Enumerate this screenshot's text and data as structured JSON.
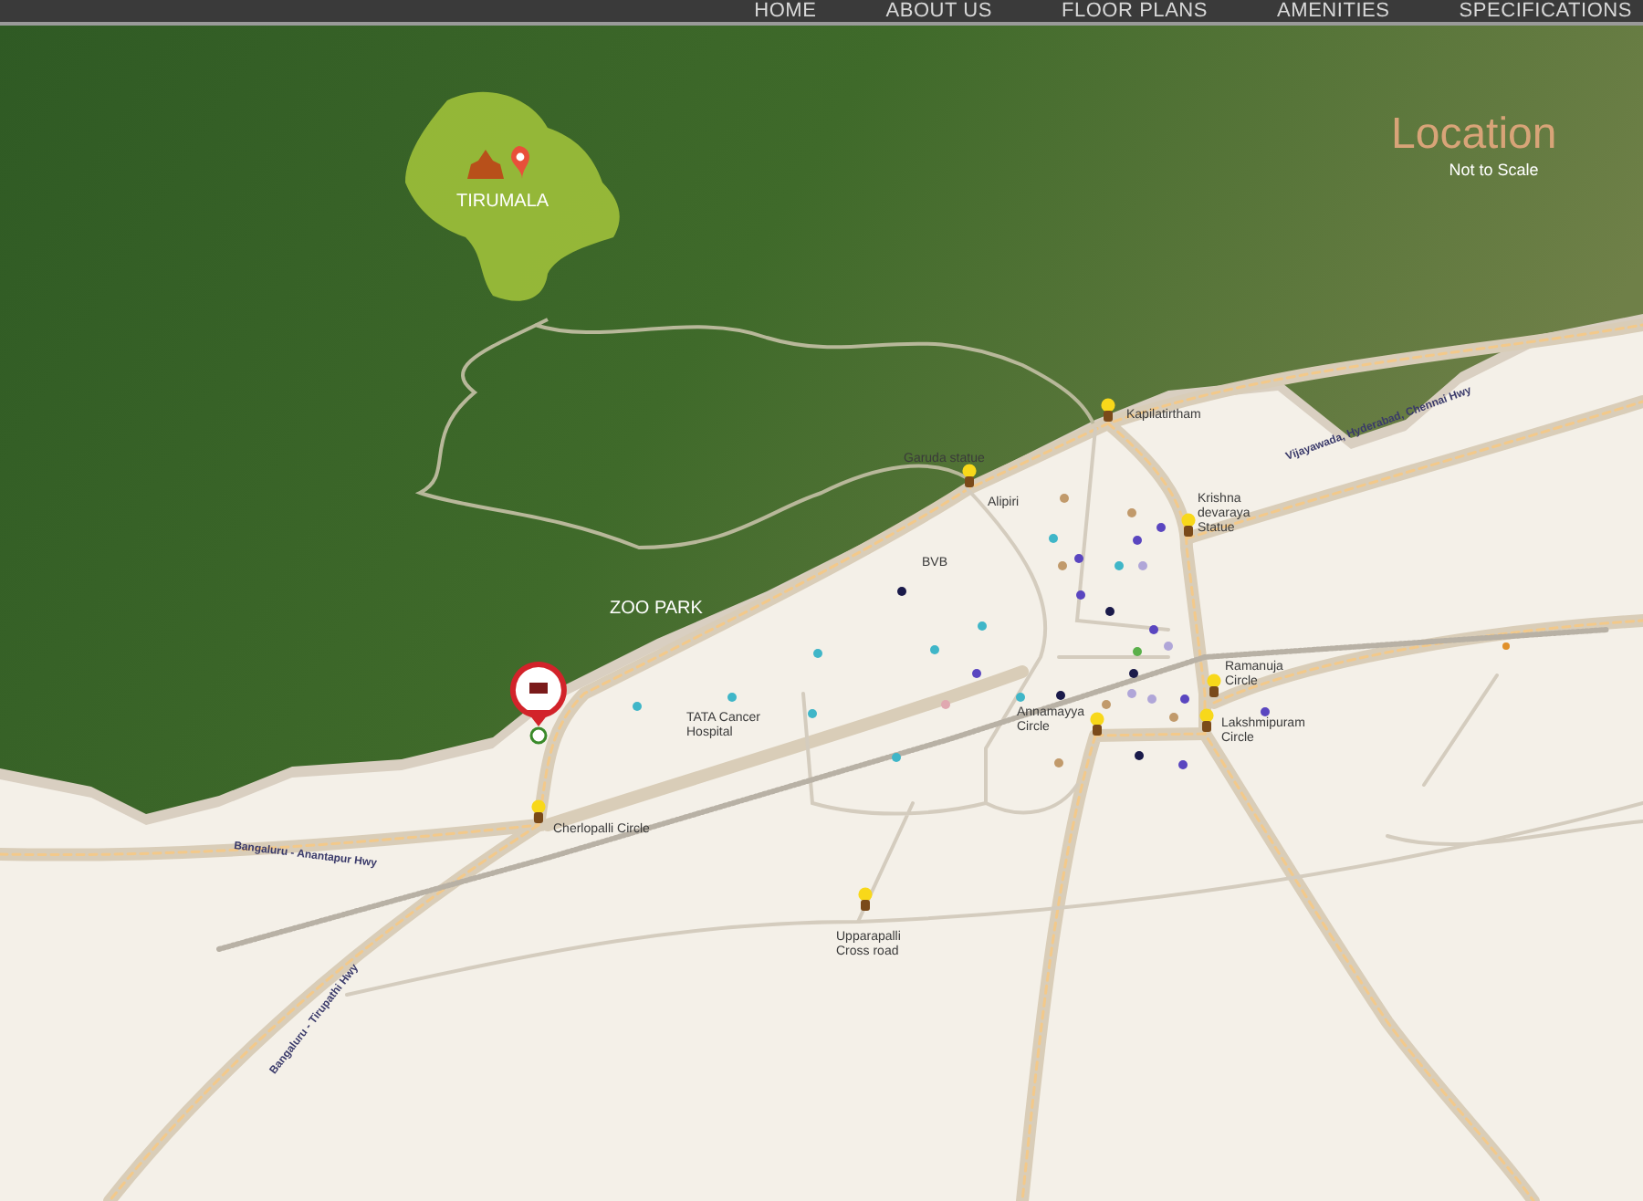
{
  "nav": [
    {
      "label": "HOME"
    },
    {
      "label": "ABOUT US"
    },
    {
      "label": "FLOOR PLANS"
    },
    {
      "label": "AMENITIES"
    },
    {
      "label": "SPECIFICATIONS"
    }
  ],
  "heading": {
    "title": "Location",
    "note": "Not to Scale"
  },
  "places": [
    {
      "kind": "area",
      "label": "TIRUMALA"
    },
    {
      "kind": "area",
      "label": "ZOO PARK"
    },
    {
      "kind": "landmark",
      "label": "Garuda statue"
    },
    {
      "kind": "landmark",
      "label": "Kapilatirtham"
    },
    {
      "kind": "plain",
      "label": "Alipiri"
    },
    {
      "kind": "landmark",
      "label": "Krishna devaraya Statue"
    },
    {
      "kind": "plain",
      "label": "BVB"
    },
    {
      "kind": "plain",
      "label": "TATA Cancer Hospital"
    },
    {
      "kind": "landmark",
      "label": "Ramanuja Circle"
    },
    {
      "kind": "landmark",
      "label": "Annamayya Circle"
    },
    {
      "kind": "landmark",
      "label": "Lakshmipuram Circle"
    },
    {
      "kind": "landmark",
      "label": "Cherlopalli Circle"
    },
    {
      "kind": "landmark",
      "label": "Upparapalli Cross road"
    },
    {
      "kind": "road",
      "label": "Bangaluru - Anantapur Hwy"
    },
    {
      "kind": "road",
      "label": "Bangaluru - Tirupathi Hwy"
    },
    {
      "kind": "road",
      "label": "Vijayawada, Hyderabad, Chennai Hwy"
    }
  ]
}
